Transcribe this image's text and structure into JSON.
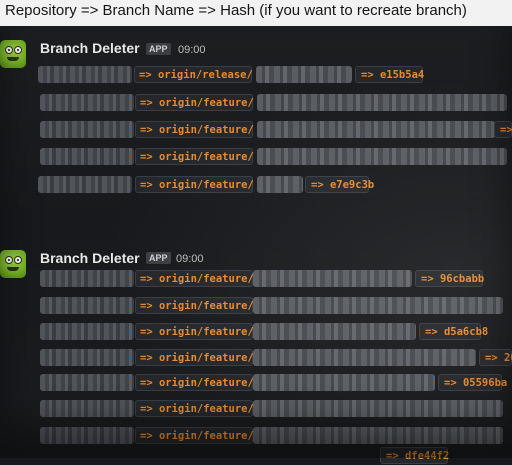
{
  "caption": "Repository => Branch Name => Hash (if you want to recreate branch)",
  "messages": [
    {
      "sender": "Branch Deleter",
      "badge": "APP",
      "time": "09:00",
      "lines": [
        {
          "branch": "=> origin/release/",
          "hash": "=> e15b5a4"
        },
        {
          "branch": "=> origin/feature/",
          "hash": ""
        },
        {
          "branch": "=> origin/feature/",
          "hash": "=>"
        },
        {
          "branch": "=> origin/feature/",
          "hash": ""
        },
        {
          "branch": "=> origin/feature/",
          "hash": "=> e7e9c3b"
        }
      ]
    },
    {
      "sender": "Branch Deleter",
      "badge": "APP",
      "time": "09:00",
      "lines": [
        {
          "branch": "=> origin/feature/",
          "hash": "=> 96cbabb"
        },
        {
          "branch": "=> origin/feature/",
          "hash": ""
        },
        {
          "branch": "=> origin/feature/",
          "hash": "=> d5a6cb8"
        },
        {
          "branch": "=> origin/feature/",
          "hash": "=> 20"
        },
        {
          "branch": "=> origin/feature/",
          "hash": "=> 05596ba"
        },
        {
          "branch": "=> origin/feature/",
          "hash": ""
        },
        {
          "branch": "=> origin/feature/",
          "hash": ""
        },
        {
          "branch": "",
          "hash": "=> dfe44f2"
        }
      ]
    }
  ]
}
